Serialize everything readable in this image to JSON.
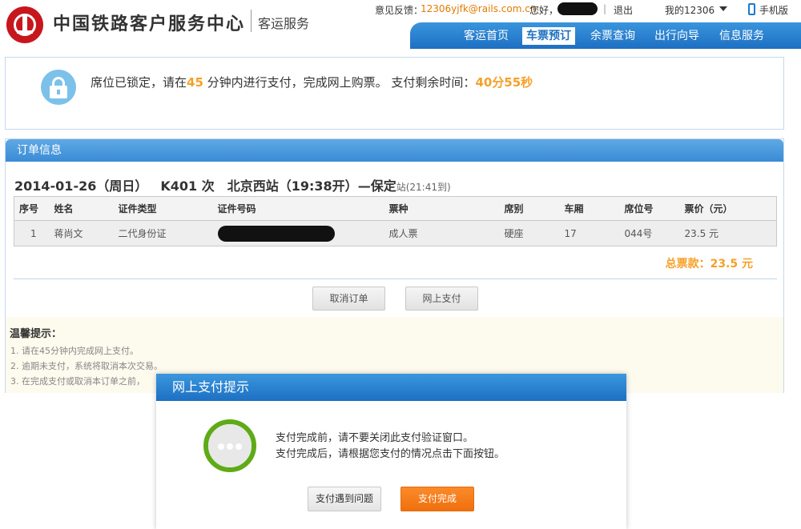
{
  "header": {
    "site_title": "中国铁路客户服务中心",
    "site_subtitle": "客运服务",
    "feedback_label": "意见反馈：",
    "feedback_email": "12306yjfk@rails.com.cn",
    "greeting": "您好，",
    "separator": "|",
    "logout": "退出",
    "my_account": "我的12306",
    "mobile": "手机版"
  },
  "nav": {
    "items": [
      {
        "label": "客运首页"
      },
      {
        "label": "车票预订"
      },
      {
        "label": "余票查询"
      },
      {
        "label": "出行向导"
      },
      {
        "label": "信息服务"
      }
    ],
    "active_index": 1
  },
  "lock_notice": {
    "prefix": "席位已锁定，请在",
    "minutes": "45",
    "middle": " 分钟内进行支付，完成网上购票。 支付剩余时间：",
    "remaining": "40分55秒"
  },
  "order": {
    "panel_title": "订单信息",
    "date": "2014-01-26（周日）",
    "train": "K401 次",
    "from_station": "北京西",
    "from_suffix": "站（19:38开）",
    "to_station": "—保定",
    "to_suffix": "站",
    "arrive": "(21:41到)",
    "columns": [
      "序号",
      "姓名",
      "证件类型",
      "证件号码",
      "票种",
      "席别",
      "车厢",
      "席位号",
      "票价（元）"
    ],
    "rows": [
      {
        "no": "1",
        "name": "蒋尚文",
        "id_type": "二代身份证",
        "id_number": "",
        "ticket_type": "成人票",
        "seat_class": "硬座",
        "car": "17",
        "seat_no": "044号",
        "price": "23.5 元"
      }
    ],
    "total": "总票款：23.5 元",
    "cancel_button": "取消订单",
    "pay_button": "网上支付"
  },
  "tips": {
    "title": "温馨提示：",
    "items": [
      "1.  请在45分钟内完成网上支付。",
      "2.  逾期未支付，系统将取消本次交易。",
      "3.  在完成支付或取消本订单之前，"
    ]
  },
  "modal": {
    "title": "网上支付提示",
    "line1": "支付完成前，请不要关闭此支付验证窗口。",
    "line2": "支付完成后，请根据您支付的情况点击下面按钮。",
    "problem_button": "支付遇到问题",
    "done_button": "支付完成"
  },
  "colors": {
    "brand_red": "#c8161d",
    "nav_blue": "#1d6fc2",
    "highlight_orange": "#f6a029",
    "done_orange": "#f06f0c",
    "wait_green": "#5fab17"
  }
}
